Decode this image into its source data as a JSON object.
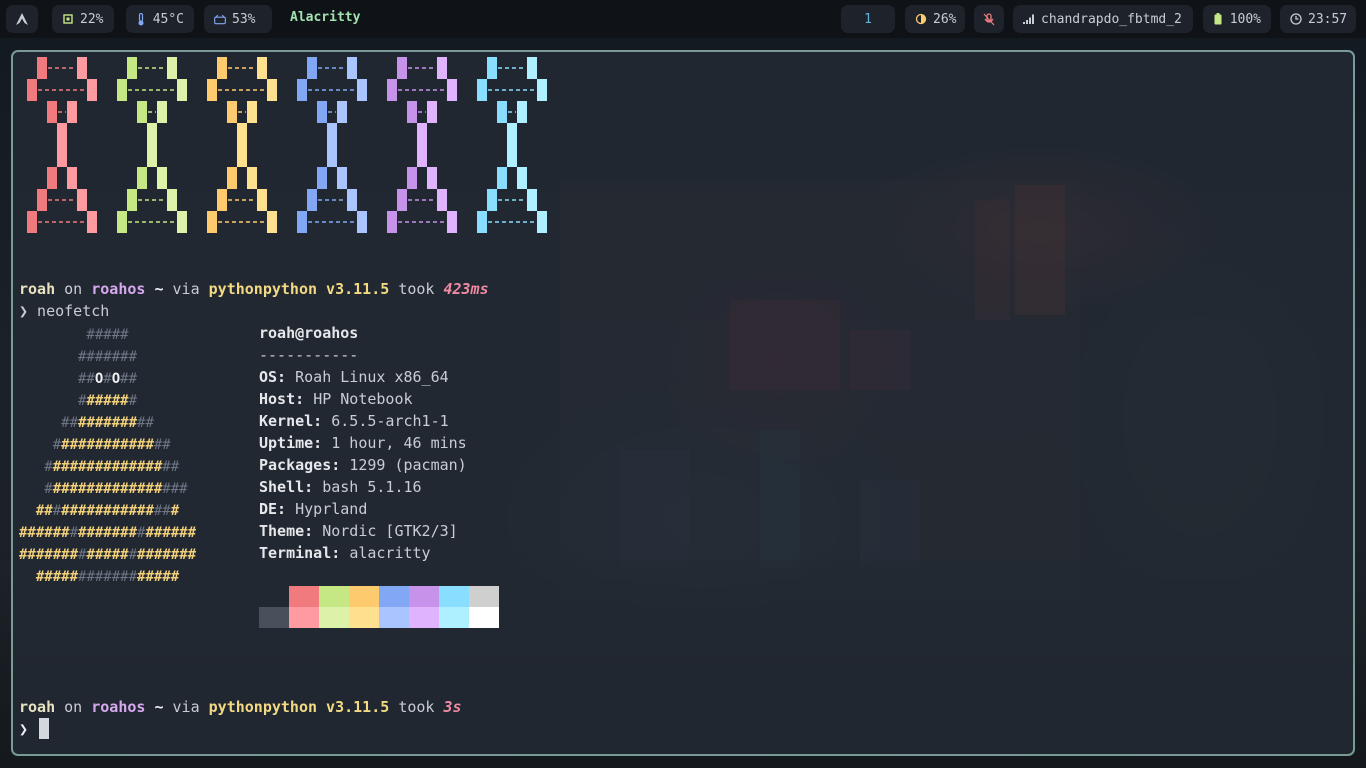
{
  "topbar": {
    "logo": "launcher-icon",
    "cpu": "22%",
    "temp": "45°C",
    "disk": "53%",
    "window_title": "Alacritty",
    "workspace": "1",
    "brightness": "26%",
    "network": "chandrapdo_fbtmd_2",
    "battery": "100%",
    "clock": "23:57"
  },
  "colors": {
    "red": "#f07a7e",
    "green": "#c5e884",
    "yellow": "#fdcb6e",
    "blue": "#82a8f5",
    "magenta": "#c792ea",
    "cyan": "#89ddff",
    "red_b": "#ff9aa0",
    "green_b": "#dcf2a8",
    "yellow_b": "#ffe08f",
    "blue_b": "#a9c4ff",
    "magenta_b": "#e0b3ff",
    "cyan_b": "#aef0ff",
    "grey": "#cfcfcf",
    "dark": "#4a4f5c",
    "white": "#ffffff"
  },
  "prompt1": {
    "user": "roah",
    "on": "on",
    "host": "roahos",
    "path": "~",
    "via": "via",
    "lang": "pythonpython v3.11.5",
    "took": "took",
    "duration": "423ms"
  },
  "command": "❯ neofetch",
  "neofetch": {
    "title": "roah@roahos",
    "separator": "-----------",
    "fields": [
      {
        "key": "OS:",
        "value": "Roah Linux x86_64"
      },
      {
        "key": "Host:",
        "value": "HP Notebook"
      },
      {
        "key": "Kernel:",
        "value": "6.5.5-arch1-1"
      },
      {
        "key": "Uptime:",
        "value": "1 hour, 46 mins"
      },
      {
        "key": "Packages:",
        "value": "1299 (pacman)"
      },
      {
        "key": "Shell:",
        "value": "bash 5.1.16"
      },
      {
        "key": "DE:",
        "value": "Hyprland"
      },
      {
        "key": "Theme:",
        "value": "Nordic [GTK2/3]"
      },
      {
        "key": "Terminal:",
        "value": "alacritty"
      }
    ]
  },
  "prompt2": {
    "user": "roah",
    "on": "on",
    "host": "roahos",
    "path": "~",
    "via": "via",
    "lang": "pythonpython v3.11.5",
    "took": "took",
    "duration": "3s"
  },
  "prompt_char": "❯"
}
